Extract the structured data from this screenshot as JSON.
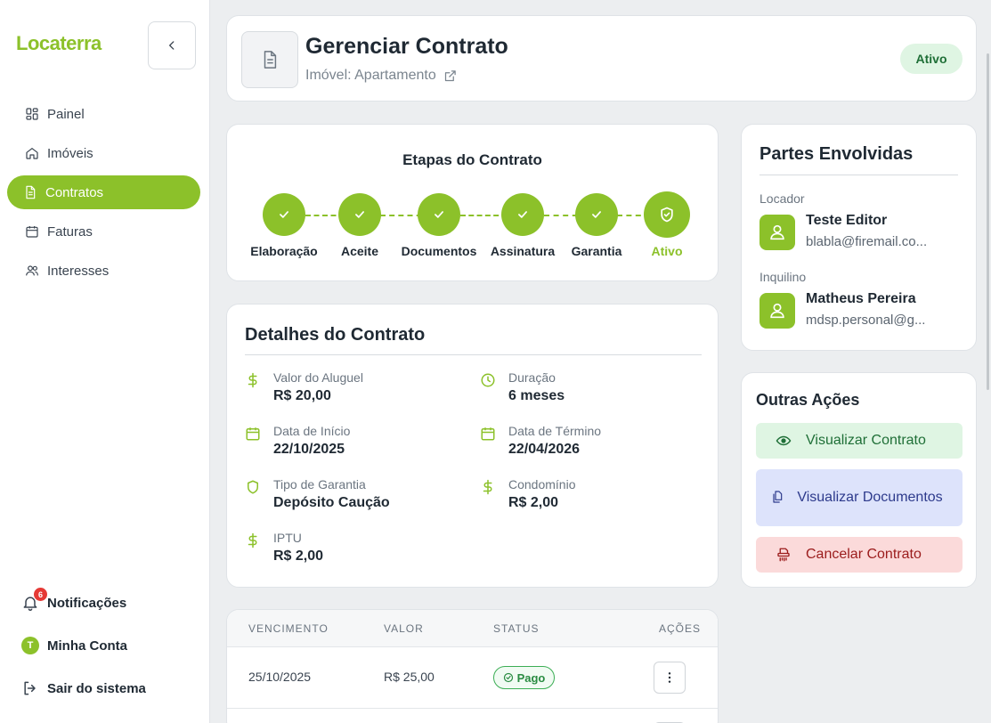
{
  "app": {
    "logo": "Locaterra"
  },
  "sidebar": {
    "items": [
      {
        "label": "Painel",
        "icon": "dashboard-icon",
        "active": false
      },
      {
        "label": "Imóveis",
        "icon": "home-icon",
        "active": false
      },
      {
        "label": "Contratos",
        "icon": "document-icon",
        "active": true
      },
      {
        "label": "Faturas",
        "icon": "calendar-icon",
        "active": false
      },
      {
        "label": "Interesses",
        "icon": "users-icon",
        "active": false
      }
    ],
    "notifications": {
      "label": "Notificações",
      "count": "6"
    },
    "account": {
      "label": "Minha Conta",
      "initial": "T"
    },
    "logout": {
      "label": "Sair do sistema"
    }
  },
  "header": {
    "title": "Gerenciar Contrato",
    "subtitle": "Imóvel: Apartamento",
    "status": "Ativo"
  },
  "steps": {
    "title": "Etapas do Contrato",
    "items": [
      {
        "label": "Elaboração",
        "done": true
      },
      {
        "label": "Aceite",
        "done": true
      },
      {
        "label": "Documentos",
        "done": true
      },
      {
        "label": "Assinatura",
        "done": true
      },
      {
        "label": "Garantia",
        "done": true
      },
      {
        "label": "Ativo",
        "current": true
      }
    ]
  },
  "details": {
    "title": "Detalhes do Contrato",
    "rent": {
      "label": "Valor do Aluguel",
      "value": "R$ 20,00"
    },
    "duration": {
      "label": "Duração",
      "value": "6 meses"
    },
    "start": {
      "label": "Data de Início",
      "value": "22/10/2025"
    },
    "end": {
      "label": "Data de Término",
      "value": "22/04/2026"
    },
    "guarantee": {
      "label": "Tipo de Garantia",
      "value": "Depósito Caução"
    },
    "condo": {
      "label": "Condomínio",
      "value": "R$ 2,00"
    },
    "iptu": {
      "label": "IPTU",
      "value": "R$ 2,00"
    }
  },
  "invoices": {
    "columns": [
      "VENCIMENTO",
      "VALOR",
      "STATUS",
      "AÇÕES"
    ],
    "rows": [
      {
        "due": "25/10/2025",
        "amount": "R$ 25,00",
        "status": "Pago"
      }
    ]
  },
  "parties": {
    "title": "Partes Envolvidas",
    "landlord": {
      "role": "Locador",
      "name": "Teste Editor",
      "email": "blabla@firemail.co..."
    },
    "tenant": {
      "role": "Inquilino",
      "name": "Matheus Pereira",
      "email": "mdsp.personal@g..."
    }
  },
  "actions": {
    "title": "Outras Ações",
    "view_contract": "Visualizar Contrato",
    "view_documents": "Visualizar Documentos",
    "cancel_contract": "Cancelar Contrato"
  },
  "colors": {
    "brand": "#8cc12a",
    "active_bg": "#dff5e3",
    "docs_bg": "#dde3fb",
    "danger_bg": "#fbdada",
    "badge_red": "#e53935"
  }
}
